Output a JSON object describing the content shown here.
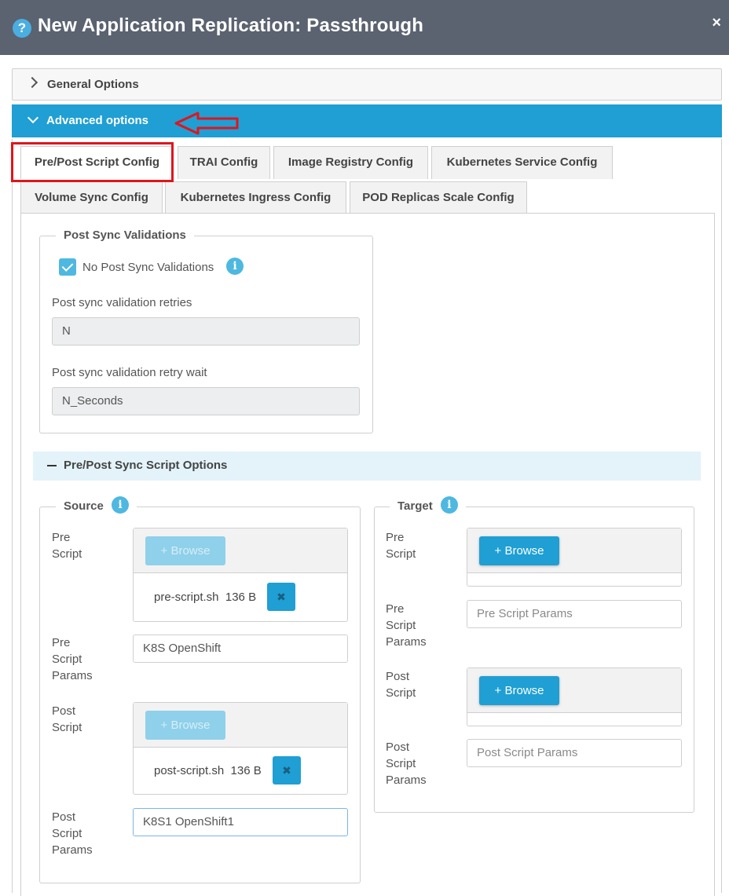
{
  "dialog": {
    "title": "New Application Replication: Passthrough",
    "close_glyph": "×",
    "help_glyph": "?"
  },
  "panels": {
    "general": {
      "label": "General Options"
    },
    "advanced": {
      "label": "Advanced options"
    }
  },
  "tabs": [
    {
      "label": "Pre/Post Script Config",
      "active": true
    },
    {
      "label": "TRAI Config"
    },
    {
      "label": "Image Registry Config"
    },
    {
      "label": "Kubernetes Service Config"
    },
    {
      "label": "Volume Sync Config"
    },
    {
      "label": "Kubernetes Ingress Config"
    },
    {
      "label": "POD Replicas Scale Config"
    }
  ],
  "post_sync": {
    "legend": "Post Sync Validations",
    "checkbox_label": "No Post Sync Validations",
    "checked": true,
    "retries_label": "Post sync validation retries",
    "retries_value": "N",
    "retry_wait_label": "Post sync validation retry wait",
    "retry_wait_value": "N_Seconds"
  },
  "script_options": {
    "label": "Pre/Post Sync Script Options",
    "source": {
      "legend": "Source",
      "pre_script_label": [
        "Pre",
        "Script"
      ],
      "browse_label": "Browse",
      "pre_file": {
        "name": "pre-script.sh",
        "size": "136 B"
      },
      "pre_params_label": [
        "Pre",
        "Script",
        "Params"
      ],
      "pre_params_value": "K8S OpenShift",
      "post_script_label": [
        "Post",
        "Script"
      ],
      "post_file": {
        "name": "post-script.sh",
        "size": "136 B"
      },
      "post_params_label": [
        "Post",
        "Script",
        "Params"
      ],
      "post_params_value": "K8S1 OpenShift1"
    },
    "target": {
      "legend": "Target",
      "pre_script_label": [
        "Pre",
        "Script"
      ],
      "browse_label": "Browse",
      "pre_params_label": [
        "Pre",
        "Script",
        "Params"
      ],
      "pre_params_placeholder": "Pre Script Params",
      "post_script_label": [
        "Post",
        "Script"
      ],
      "post_params_label": [
        "Post",
        "Script",
        "Params"
      ],
      "post_params_placeholder": "Post Script Params"
    }
  },
  "colors": {
    "titlebar": "#5b6270",
    "accent": "#1f9fd3",
    "highlight": "#e0151c"
  }
}
